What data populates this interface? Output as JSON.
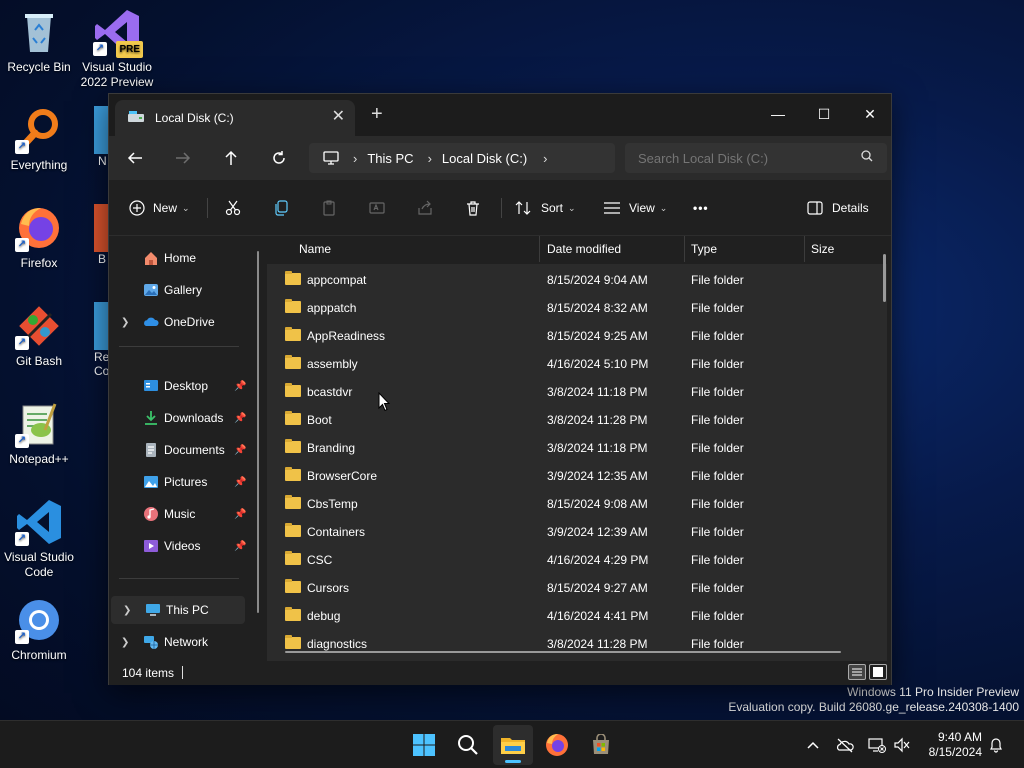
{
  "desktop": {
    "icons": [
      {
        "label": "Recycle Bin",
        "icon": "recycle-bin-icon"
      },
      {
        "label": "Visual Studio 2022 Preview",
        "icon": "visual-studio-icon",
        "badge": "PRE"
      },
      {
        "label": "Everything",
        "icon": "everything-search-icon"
      },
      {
        "label": "Firefox",
        "icon": "firefox-icon"
      },
      {
        "label": "Git Bash",
        "icon": "git-bash-icon"
      },
      {
        "label": "Notepad++",
        "icon": "notepad-plus-plus-icon"
      },
      {
        "label": "Visual Studio Code",
        "icon": "vscode-icon"
      },
      {
        "label": "Chromium",
        "icon": "chromium-icon"
      }
    ],
    "partial_labels": [
      "N",
      "B",
      "Re",
      "Co"
    ],
    "watermark": {
      "line1": "Windows 11 Pro Insider Preview",
      "line2": "Evaluation copy. Build 26080.ge_release.240308-1400"
    }
  },
  "window": {
    "tab_title": "Local Disk (C:)",
    "new_tab_glyph": "+",
    "close_glyph": "✕",
    "controls": {
      "minimize": "—",
      "maximize": "☐",
      "close": "✕"
    }
  },
  "navbar": {
    "breadcrumbs": [
      "This PC",
      "Local Disk (C:)"
    ],
    "search_placeholder": "Search Local Disk (C:)"
  },
  "toolbar": {
    "new_label": "New",
    "sort_label": "Sort",
    "view_label": "View",
    "more_label": "•••",
    "details_label": "Details"
  },
  "sidebar": {
    "top": [
      {
        "label": "Home",
        "icon": "home-icon"
      },
      {
        "label": "Gallery",
        "icon": "gallery-icon"
      },
      {
        "label": "OneDrive",
        "icon": "onedrive-icon",
        "expandable": true
      }
    ],
    "pinned": [
      {
        "label": "Desktop",
        "icon": "desktop-folder-icon"
      },
      {
        "label": "Downloads",
        "icon": "downloads-folder-icon"
      },
      {
        "label": "Documents",
        "icon": "documents-folder-icon"
      },
      {
        "label": "Pictures",
        "icon": "pictures-folder-icon"
      },
      {
        "label": "Music",
        "icon": "music-folder-icon"
      },
      {
        "label": "Videos",
        "icon": "videos-folder-icon"
      }
    ],
    "bottom": [
      {
        "label": "This PC",
        "icon": "this-pc-icon",
        "selected": true
      },
      {
        "label": "Network",
        "icon": "network-icon"
      }
    ]
  },
  "columns": [
    "Name",
    "Date modified",
    "Type",
    "Size"
  ],
  "files": [
    {
      "name": "appcompat",
      "date": "8/15/2024 9:04 AM",
      "type": "File folder"
    },
    {
      "name": "apppatch",
      "date": "8/15/2024 8:32 AM",
      "type": "File folder"
    },
    {
      "name": "AppReadiness",
      "date": "8/15/2024 9:25 AM",
      "type": "File folder"
    },
    {
      "name": "assembly",
      "date": "4/16/2024 5:10 PM",
      "type": "File folder"
    },
    {
      "name": "bcastdvr",
      "date": "3/8/2024 11:18 PM",
      "type": "File folder"
    },
    {
      "name": "Boot",
      "date": "3/8/2024 11:28 PM",
      "type": "File folder"
    },
    {
      "name": "Branding",
      "date": "3/8/2024 11:18 PM",
      "type": "File folder"
    },
    {
      "name": "BrowserCore",
      "date": "3/9/2024 12:35 AM",
      "type": "File folder"
    },
    {
      "name": "CbsTemp",
      "date": "8/15/2024 9:08 AM",
      "type": "File folder"
    },
    {
      "name": "Containers",
      "date": "3/9/2024 12:39 AM",
      "type": "File folder"
    },
    {
      "name": "CSC",
      "date": "4/16/2024 4:29 PM",
      "type": "File folder"
    },
    {
      "name": "Cursors",
      "date": "8/15/2024 9:27 AM",
      "type": "File folder"
    },
    {
      "name": "debug",
      "date": "4/16/2024 4:41 PM",
      "type": "File folder"
    },
    {
      "name": "diagnostics",
      "date": "3/8/2024 11:28 PM",
      "type": "File folder"
    }
  ],
  "status": {
    "item_count": "104 items"
  },
  "taskbar": {
    "time": "9:40 AM",
    "date": "8/15/2024",
    "apps": [
      "start-icon",
      "search-icon",
      "file-explorer-icon",
      "firefox-icon",
      "store-icon"
    ]
  }
}
